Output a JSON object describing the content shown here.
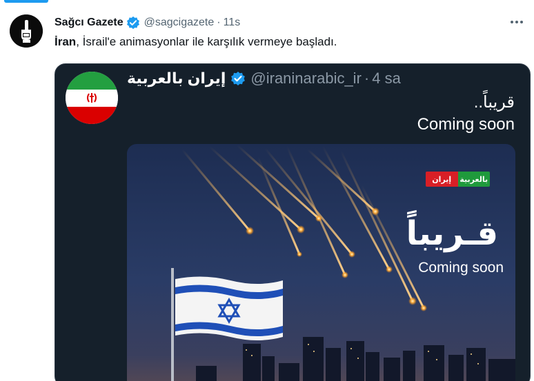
{
  "accent_color": "#1d9bf0",
  "tweet": {
    "author_name": "Sağcı Gazete",
    "author_handle": "@sagcigazete",
    "separator": "·",
    "time": "11s",
    "text_bold": "İran",
    "text_rest": ", İsrail'e animasyonlar ile karşılık vermeye başladı.",
    "avatar_icon": "fist-logo-icon",
    "verified_icon": "verified-badge-icon",
    "more_icon": "more-options-icon"
  },
  "quoted": {
    "author_name": "إيران بالعربية",
    "author_handle": "@iraninarabic_ir",
    "separator": "·",
    "time": "4 sa",
    "line1": "قريباً..",
    "line2": "Coming soon",
    "avatar_icon": "iran-flag-icon",
    "media": {
      "logo_left": "إيران",
      "logo_right": "بالعربية",
      "arabic_title": "قـريباً",
      "subtitle": "Coming soon",
      "flag_icon": "israel-flag-icon"
    }
  }
}
